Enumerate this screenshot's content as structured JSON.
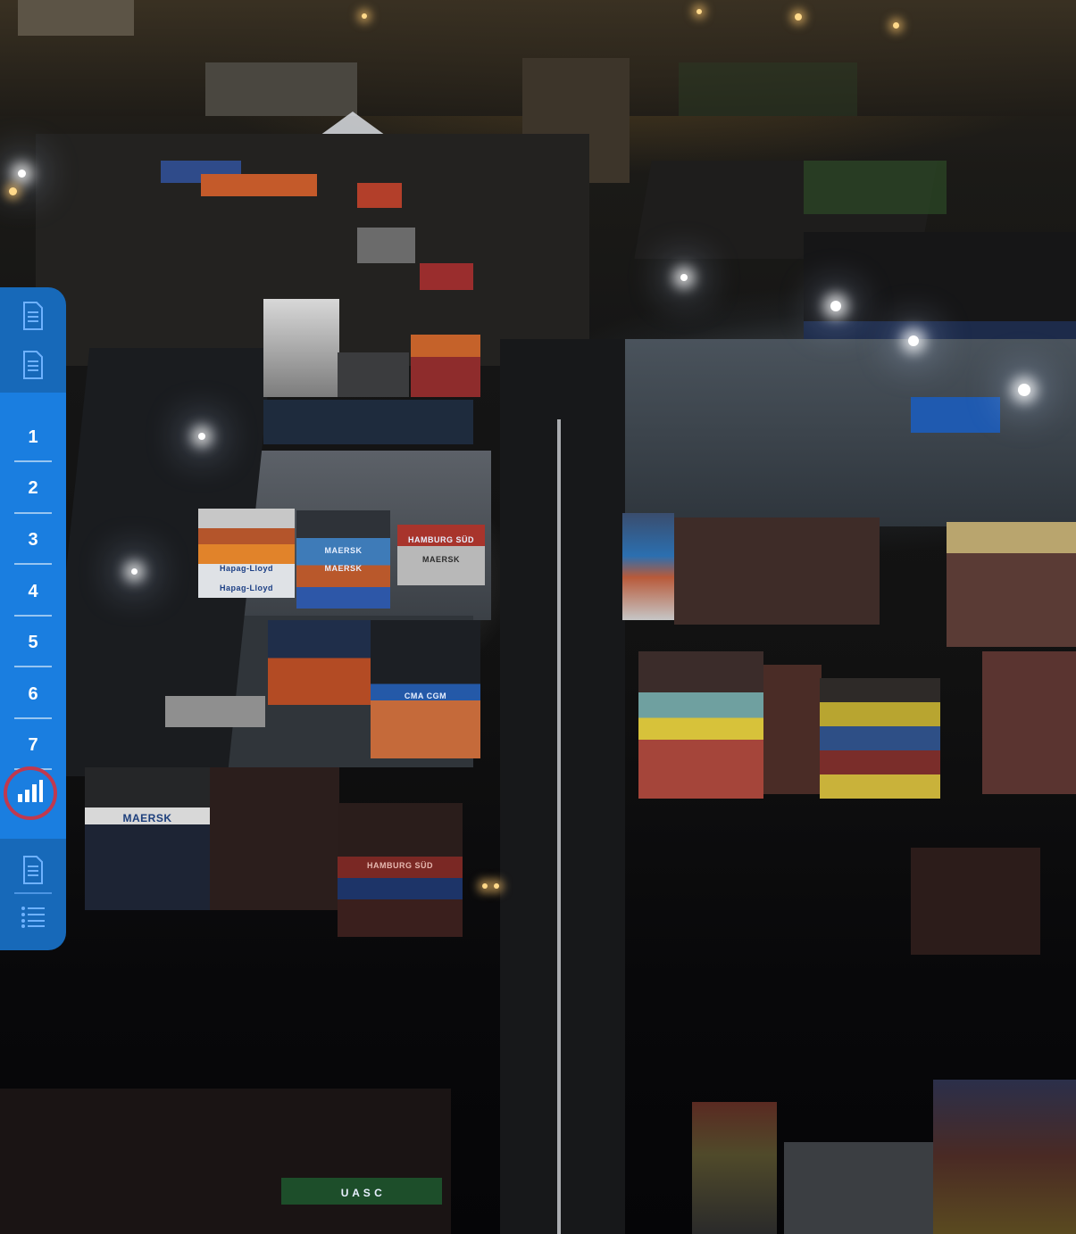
{
  "container_labels": {
    "maersk": "MAERSK",
    "hapag": "Hapag-Lloyd",
    "hamburg": "HAMBURG SÜD",
    "cma": "CMA CGM",
    "uasc": "U A S C"
  },
  "sidebar": {
    "top_docs": [
      {
        "icon": "document-icon"
      },
      {
        "icon": "document-icon"
      }
    ],
    "chapters": [
      {
        "label": "1"
      },
      {
        "label": "2"
      },
      {
        "label": "3"
      },
      {
        "label": "4"
      },
      {
        "label": "5"
      },
      {
        "label": "6"
      },
      {
        "label": "7"
      }
    ],
    "active_item": {
      "icon": "bar-chart-icon"
    },
    "bottom_items": [
      {
        "icon": "document-icon"
      },
      {
        "icon": "list-icon"
      }
    ],
    "colors": {
      "dark": "#1769b9",
      "mid": "#1a7ee0",
      "highlight_ring": "#c0394f"
    }
  }
}
